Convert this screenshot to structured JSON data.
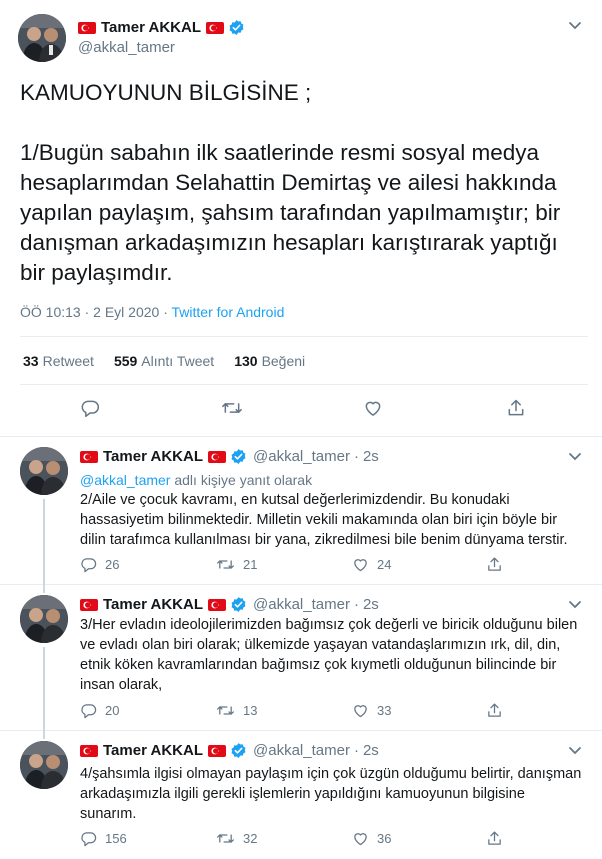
{
  "icons": {
    "reply": "reply-icon",
    "retweet": "retweet-icon",
    "like": "heart-icon",
    "share": "share-icon",
    "more": "chevron-down-icon",
    "verified": "verified-badge-icon",
    "flag": "turkey-flag-icon"
  },
  "colors": {
    "accent": "#1da1f2",
    "flag_red": "#e30a17",
    "muted": "#657786",
    "text": "#14171a"
  },
  "main_tweet": {
    "author": {
      "name": "Tamer AKKAL",
      "handle": "@akkal_tamer"
    },
    "text": {
      "line1": "KAMUOYUNUN BİLGİSİNE ;",
      "line2": "1/Bugün sabahın ilk saatlerinde resmi sosyal medya hesaplarımdan Selahattin Demirtaş ve ailesi hakkında yapılan paylaşım, şahsım tarafından yapılmamıştır; bir danışman arkadaşımızın hesapları karıştırarak yaptığı bir paylaşımdır."
    },
    "time": "ÖÖ 10:13",
    "date": "2 Eyl 2020",
    "separator": "·",
    "source": "Twitter for Android",
    "stats": {
      "retweets": "33",
      "retweets_label": "Retweet",
      "quotes": "559",
      "quotes_label": "Alıntı Tweet",
      "likes": "130",
      "likes_label": "Beğeni"
    }
  },
  "replies": [
    {
      "name": "Tamer AKKAL",
      "handle": "@akkal_tamer",
      "time": "2s",
      "dot": "·",
      "reply_to_mention": "@akkal_tamer",
      "reply_to_suffix": "adlı kişiye yanıt olarak",
      "text": "2/Aile ve çocuk kavramı, en kutsal değerlerimizdendir. Bu konudaki hassasiyetim bilinmektedir. Milletin vekili makamında olan biri için böyle bir dilin tarafımca kullanılması bir yana, zikredilmesi bile benim dünyama terstir.",
      "replies": "26",
      "retweets": "21",
      "likes": "24"
    },
    {
      "name": "Tamer AKKAL",
      "handle": "@akkal_tamer",
      "time": "2s",
      "dot": "·",
      "text": "3/Her evladın ideolojilerimizden bağımsız çok değerli ve biricik olduğunu bilen ve evladı olan biri olarak; ülkemizde yaşayan vatandaşlarımızın ırk, dil, din, etnik köken kavramlarından bağımsız çok kıymetli olduğunun bilincinde bir insan olarak,",
      "replies": "20",
      "retweets": "13",
      "likes": "33"
    },
    {
      "name": "Tamer AKKAL",
      "handle": "@akkal_tamer",
      "time": "2s",
      "dot": "·",
      "text": "4/şahsımla ilgisi olmayan paylaşım için çok üzgün olduğumu belirtir, danışman arkadaşımızla ilgili gerekli işlemlerin yapıldığını kamuoyunun bilgisine sunarım.",
      "replies": "156",
      "retweets": "32",
      "likes": "36"
    }
  ]
}
